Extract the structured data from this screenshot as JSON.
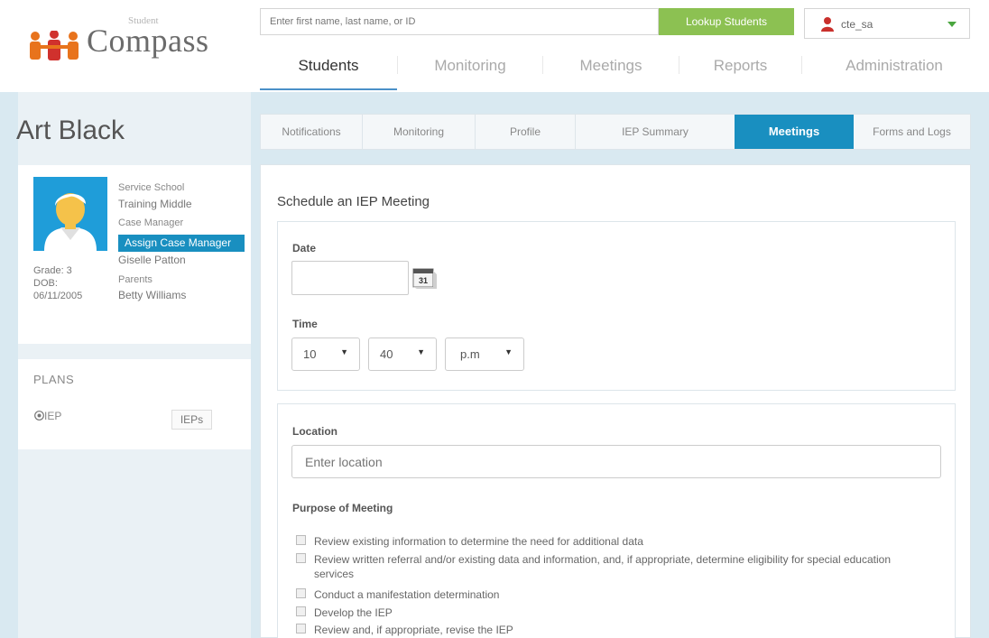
{
  "header": {
    "logo_small": "Student",
    "logo_name": "Compass",
    "search_placeholder": "Enter first name, last name, or ID",
    "lookup_label": "Lookup Students",
    "user_name": "cte_sa"
  },
  "topnav": [
    "Students",
    "Monitoring",
    "Meetings",
    "Reports",
    "Administration"
  ],
  "student": {
    "name": "Art Black",
    "service_school_label": "Service School",
    "service_school": "Training Middle",
    "case_manager_label": "Case Manager",
    "assign_label": "Assign Case Manager",
    "case_manager": "Giselle Patton",
    "parents_label": "Parents",
    "parents": "Betty Williams",
    "grade": "Grade: 3",
    "dob_label": "DOB:",
    "dob": "06/11/2005"
  },
  "plans": {
    "title": "PLANS",
    "plan_label": "IEP",
    "ieps_button": "IEPs"
  },
  "subtabs": [
    "Notifications",
    "Monitoring",
    "Profile",
    "IEP Summary",
    "Meetings",
    "Forms and Logs"
  ],
  "main": {
    "title": "Schedule an IEP Meeting",
    "date_label": "Date",
    "calendar_day": "31",
    "time_label": "Time",
    "hour": "10",
    "minute": "40",
    "ampm": "p.m",
    "location_label": "Location",
    "location_placeholder": "Enter location",
    "purpose_label": "Purpose of Meeting",
    "purposes": [
      "Review existing information to determine the need for additional data",
      "Review written referral and/or existing data and information, and, if appropriate, determine eligibility for special education services",
      "Conduct a manifestation determination",
      "Develop the IEP",
      "Review and, if appropriate, revise the IEP"
    ]
  }
}
